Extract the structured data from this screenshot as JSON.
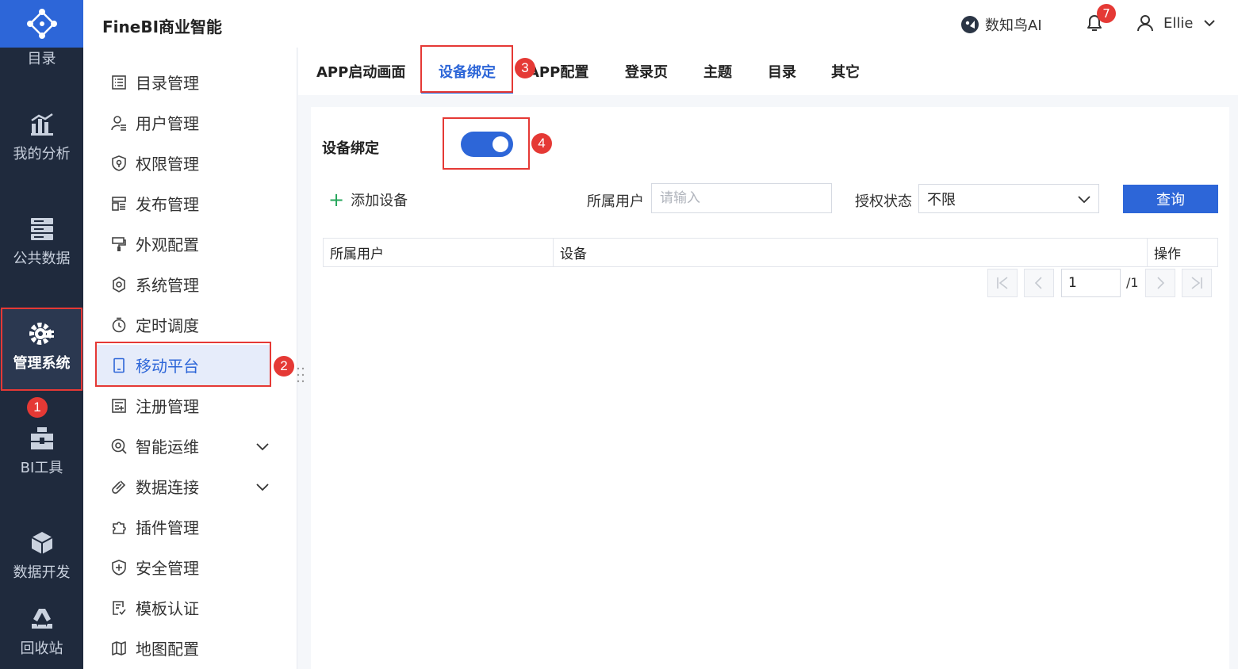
{
  "rail": {
    "items": [
      {
        "label": "目录",
        "icon": "catalog-icon"
      },
      {
        "label": "我的分析",
        "icon": "analysis-icon"
      },
      {
        "label": "公共数据",
        "icon": "database-icon"
      },
      {
        "label": "管理系统",
        "icon": "gear-icon",
        "active": true
      },
      {
        "label": "BI工具",
        "icon": "toolbox-icon"
      },
      {
        "label": "数据开发",
        "icon": "cube-icon"
      },
      {
        "label": "回收站",
        "icon": "recycle-icon"
      }
    ]
  },
  "header": {
    "title": "FineBI商业智能",
    "ai_label": "数知鸟AI",
    "notification_count": "7",
    "user_name": "Ellie"
  },
  "sidebar": {
    "items": [
      {
        "label": "目录管理",
        "icon": "list-icon"
      },
      {
        "label": "用户管理",
        "icon": "user-list-icon"
      },
      {
        "label": "权限管理",
        "icon": "shield-icon"
      },
      {
        "label": "发布管理",
        "icon": "publish-icon"
      },
      {
        "label": "外观配置",
        "icon": "brush-icon"
      },
      {
        "label": "系统管理",
        "icon": "gear-icon"
      },
      {
        "label": "定时调度",
        "icon": "timer-icon"
      },
      {
        "label": "移动平台",
        "icon": "mobile-icon",
        "active": true
      },
      {
        "label": "注册管理",
        "icon": "register-icon"
      },
      {
        "label": "智能运维",
        "icon": "ops-icon",
        "expandable": true
      },
      {
        "label": "数据连接",
        "icon": "link-icon",
        "expandable": true
      },
      {
        "label": "插件管理",
        "icon": "puzzle-icon"
      },
      {
        "label": "安全管理",
        "icon": "shield-plus-icon"
      },
      {
        "label": "模板认证",
        "icon": "certify-icon"
      },
      {
        "label": "地图配置",
        "icon": "map-icon"
      }
    ]
  },
  "tabs": {
    "items": [
      {
        "label": "APP启动画面"
      },
      {
        "label": "设备绑定",
        "active": true
      },
      {
        "label": "APP配置"
      },
      {
        "label": "登录页"
      },
      {
        "label": "主题"
      },
      {
        "label": "目录"
      },
      {
        "label": "其它"
      }
    ]
  },
  "content": {
    "bind_label": "设备绑定",
    "toggle_on": true,
    "add_device_label": "添加设备",
    "owner_label": "所属用户",
    "owner_placeholder": "请输入",
    "status_label": "授权状态",
    "status_value": "不限",
    "query_label": "查询",
    "table_headers": [
      "所属用户",
      "设备",
      "操作"
    ],
    "page_current": "1",
    "page_total": "/1"
  },
  "annotations": [
    "1",
    "2",
    "3",
    "4"
  ],
  "colors": {
    "accent": "#2d66d8",
    "rail_bg": "#1f2a3d",
    "annotation": "#e53935"
  }
}
